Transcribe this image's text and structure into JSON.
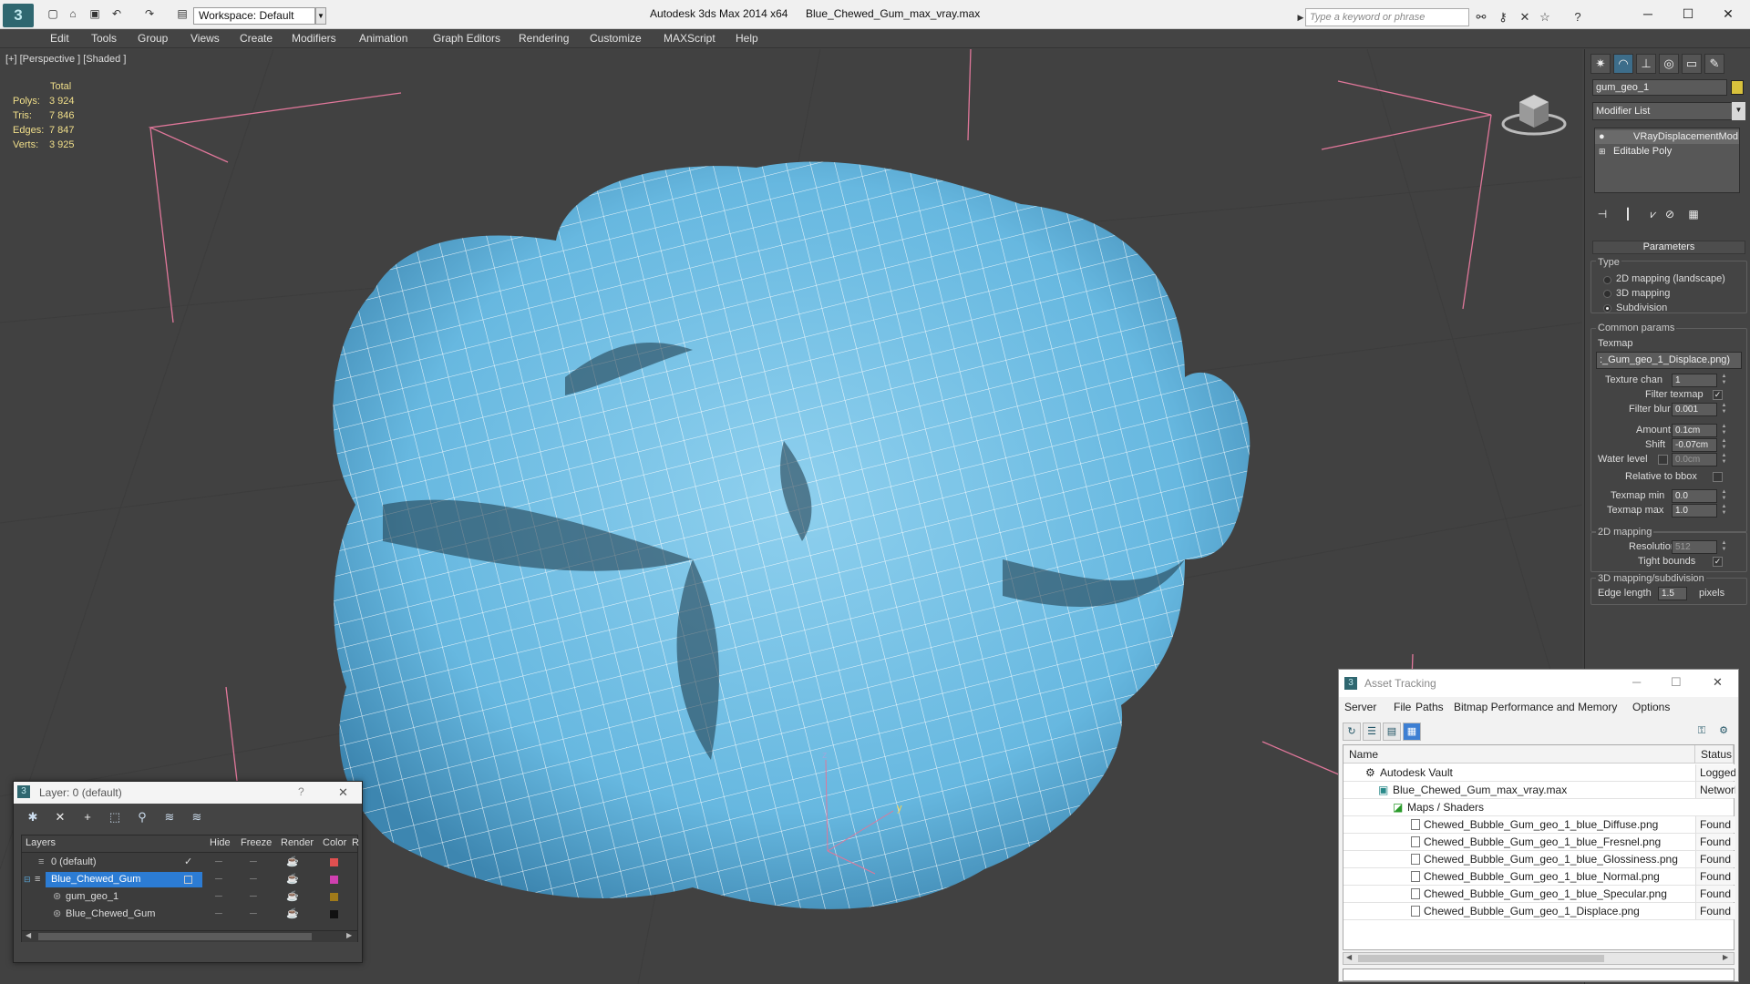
{
  "titlebar": {
    "workspace": "Workspace: Default",
    "app_title": "Autodesk 3ds Max  2014 x64",
    "file_title": "Blue_Chewed_Gum_max_vray.max",
    "search_placeholder": "Type a keyword or phrase"
  },
  "menu": [
    "Edit",
    "Tools",
    "Group",
    "Views",
    "Create",
    "Modifiers",
    "Animation",
    "Graph Editors",
    "Rendering",
    "Customize",
    "MAXScript",
    "Help"
  ],
  "viewport": {
    "label": "[+] [Perspective ] [Shaded ]",
    "stats": {
      "total_label": "Total",
      "rows": [
        {
          "label": "Polys:",
          "value": "3 924"
        },
        {
          "label": "Tris:",
          "value": "7 846"
        },
        {
          "label": "Edges:",
          "value": "7 847"
        },
        {
          "label": "Verts:",
          "value": "3 925"
        }
      ]
    },
    "gizmo": {
      "y": "y",
      "z": "z"
    }
  },
  "command_panel": {
    "object_name": "gum_geo_1",
    "modifier_list": "Modifier List",
    "stack": [
      "VRayDisplacementMod",
      "Editable Poly"
    ],
    "params_title": "Parameters",
    "type_label": "Type",
    "type_options": [
      "2D mapping (landscape)",
      "3D mapping",
      "Subdivision"
    ],
    "common_label": "Common params",
    "texmap_label": "Texmap",
    "texmap_value": ":_Gum_geo_1_Displace.png)",
    "texture_chan_label": "Texture chan",
    "texture_chan": "1",
    "filter_texmap_label": "Filter texmap",
    "filter_blur_label": "Filter blur",
    "filter_blur": "0.001",
    "amount_label": "Amount",
    "amount": "0.1cm",
    "shift_label": "Shift",
    "shift": "-0.07cm",
    "water_label": "Water level",
    "water": "0.0cm",
    "relative_label": "Relative to bbox",
    "texmap_min_label": "Texmap min",
    "texmap_min": "0.0",
    "texmap_max_label": "Texmap max",
    "texmap_max": "1.0",
    "mapping2d_label": "2D mapping",
    "resolution_label": "Resolution",
    "resolution": "512",
    "tight_label": "Tight bounds",
    "mapping3d_label": "3D mapping/subdivision",
    "edge_length_label": "Edge length",
    "edge_length": "1.5",
    "pixels_label": "pixels"
  },
  "layer_window": {
    "title": "Layer: 0 (default)",
    "help": "?",
    "close": "✕",
    "headers": [
      "Layers",
      "Hide",
      "Freeze",
      "Render",
      "Color",
      "R"
    ],
    "rows": [
      {
        "name": "0 (default)",
        "color": "#e05050"
      },
      {
        "name": "Blue_Chewed_Gum",
        "color": "#d040b0"
      },
      {
        "name": "gum_geo_1",
        "color": "#a07a1a"
      },
      {
        "name": "Blue_Chewed_Gum",
        "color": "#111111"
      }
    ]
  },
  "asset_tracking": {
    "title": "Asset Tracking",
    "menu": [
      "Server",
      "File",
      "Paths",
      "Bitmap Performance and Memory",
      "Options"
    ],
    "col_name": "Name",
    "col_status": "Status",
    "rows": [
      {
        "name": "Autodesk Vault",
        "status": "Logged"
      },
      {
        "name": "Blue_Chewed_Gum_max_vray.max",
        "status": "Network"
      },
      {
        "name": "Maps / Shaders",
        "status": ""
      },
      {
        "name": "Chewed_Bubble_Gum_geo_1_blue_Diffuse.png",
        "status": "Found"
      },
      {
        "name": "Chewed_Bubble_Gum_geo_1_blue_Fresnel.png",
        "status": "Found"
      },
      {
        "name": "Chewed_Bubble_Gum_geo_1_blue_Glossiness.png",
        "status": "Found"
      },
      {
        "name": "Chewed_Bubble_Gum_geo_1_blue_Normal.png",
        "status": "Found"
      },
      {
        "name": "Chewed_Bubble_Gum_geo_1_blue_Specular.png",
        "status": "Found"
      },
      {
        "name": "Chewed_Bubble_Gum_geo_1_Displace.png",
        "status": "Found"
      }
    ]
  }
}
